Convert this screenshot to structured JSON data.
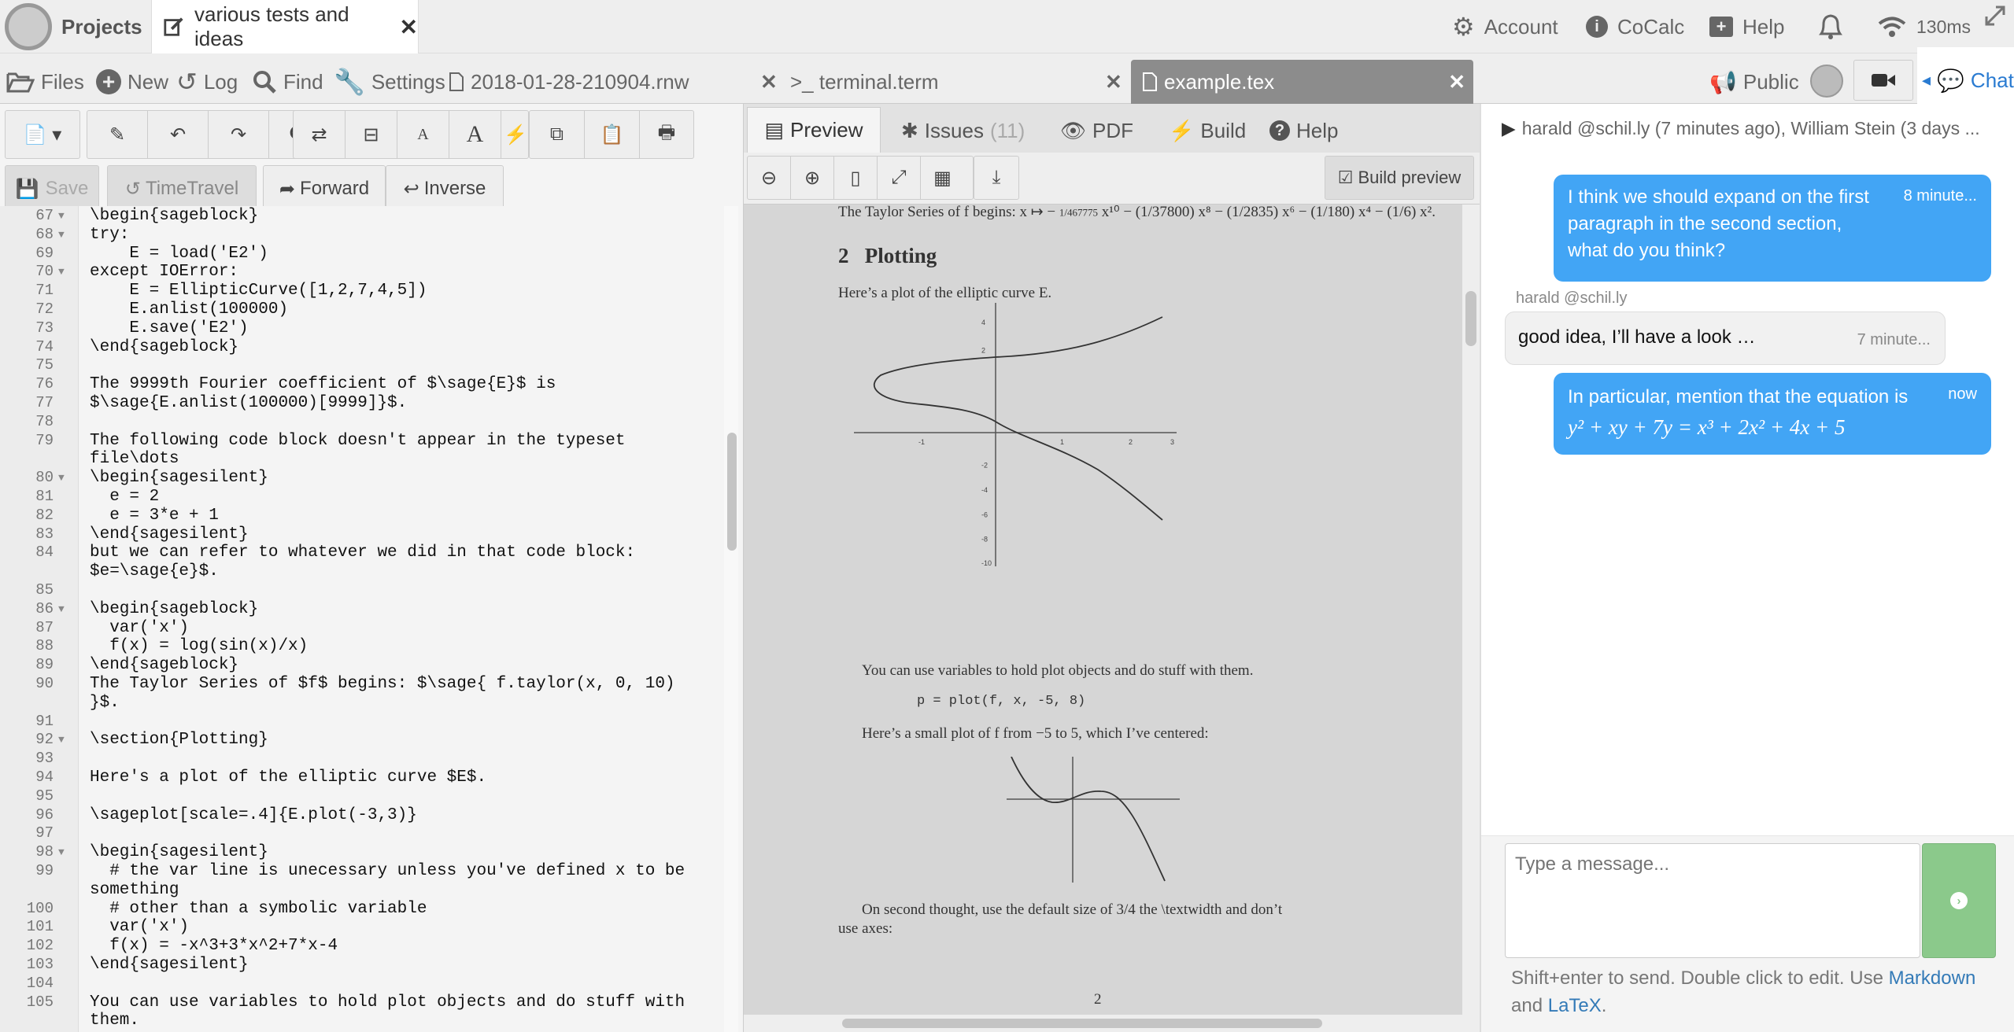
{
  "topbar": {
    "projects_label": "Projects",
    "doc_tab_title": "various tests and ideas",
    "account_label": "Account",
    "cocalc_label": "CoCalc",
    "help_label": "Help",
    "latency": "130ms"
  },
  "filebar": {
    "files": "Files",
    "new": "New",
    "log": "Log",
    "find": "Find",
    "settings": "Settings",
    "tab_rnw": "2018-01-28-210904.rnw",
    "tab_terminal": ">_ terminal.term",
    "tab_tex": "example.tex",
    "public": "Public",
    "chat": "Chat"
  },
  "editor_toolbar": {
    "save": "Save",
    "timetravel": "TimeTravel",
    "forward": "Forward",
    "inverse": "Inverse",
    "font_small": "A",
    "font_large": "A"
  },
  "code_lines": [
    {
      "n": "67",
      "fold": true,
      "text": "\\begin{sageblock}"
    },
    {
      "n": "68",
      "fold": true,
      "text": "try:"
    },
    {
      "n": "69",
      "fold": false,
      "text": "    E = load('E2')"
    },
    {
      "n": "70",
      "fold": true,
      "text": "except IOError:"
    },
    {
      "n": "71",
      "fold": false,
      "text": "    E = EllipticCurve([1,2,7,4,5])"
    },
    {
      "n": "72",
      "fold": false,
      "text": "    E.anlist(100000)"
    },
    {
      "n": "73",
      "fold": false,
      "text": "    E.save('E2')"
    },
    {
      "n": "74",
      "fold": false,
      "text": "\\end{sageblock}"
    },
    {
      "n": "75",
      "fold": false,
      "text": ""
    },
    {
      "n": "76",
      "fold": false,
      "text": "The 9999th Fourier coefficient of $\\sage{E}$ is"
    },
    {
      "n": "77",
      "fold": false,
      "text": "$\\sage{E.anlist(100000)[9999]}$."
    },
    {
      "n": "78",
      "fold": false,
      "text": ""
    },
    {
      "n": "79",
      "fold": false,
      "text": "The following code block doesn't appear in the typeset"
    },
    {
      "n": "",
      "fold": false,
      "text": "file\\dots"
    },
    {
      "n": "80",
      "fold": true,
      "text": "\\begin{sagesilent}"
    },
    {
      "n": "81",
      "fold": false,
      "text": "  e = 2"
    },
    {
      "n": "82",
      "fold": false,
      "text": "  e = 3*e + 1"
    },
    {
      "n": "83",
      "fold": false,
      "text": "\\end{sagesilent}"
    },
    {
      "n": "84",
      "fold": false,
      "text": "but we can refer to whatever we did in that code block:"
    },
    {
      "n": "",
      "fold": false,
      "text": "$e=\\sage{e}$."
    },
    {
      "n": "85",
      "fold": false,
      "text": ""
    },
    {
      "n": "86",
      "fold": true,
      "text": "\\begin{sageblock}"
    },
    {
      "n": "87",
      "fold": false,
      "text": "  var('x')"
    },
    {
      "n": "88",
      "fold": false,
      "text": "  f(x) = log(sin(x)/x)"
    },
    {
      "n": "89",
      "fold": false,
      "text": "\\end{sageblock}"
    },
    {
      "n": "90",
      "fold": false,
      "text": "The Taylor Series of $f$ begins: $\\sage{ f.taylor(x, 0, 10)"
    },
    {
      "n": "",
      "fold": false,
      "text": "}$."
    },
    {
      "n": "91",
      "fold": false,
      "text": ""
    },
    {
      "n": "92",
      "fold": true,
      "text": "\\section{Plotting}"
    },
    {
      "n": "93",
      "fold": false,
      "text": ""
    },
    {
      "n": "94",
      "fold": false,
      "text": "Here's a plot of the elliptic curve $E$."
    },
    {
      "n": "95",
      "fold": false,
      "text": ""
    },
    {
      "n": "96",
      "fold": false,
      "text": "\\sageplot[scale=.4]{E.plot(-3,3)}"
    },
    {
      "n": "97",
      "fold": false,
      "text": ""
    },
    {
      "n": "98",
      "fold": true,
      "text": "\\begin{sagesilent}"
    },
    {
      "n": "99",
      "fold": false,
      "text": "  # the var line is unecessary unless you've defined x to be"
    },
    {
      "n": "",
      "fold": false,
      "text": "something"
    },
    {
      "n": "100",
      "fold": false,
      "text": "  # other than a symbolic variable"
    },
    {
      "n": "101",
      "fold": false,
      "text": "  var('x')"
    },
    {
      "n": "102",
      "fold": false,
      "text": "  f(x) = -x^3+3*x^2+7*x-4"
    },
    {
      "n": "103",
      "fold": false,
      "text": "\\end{sagesilent}"
    },
    {
      "n": "104",
      "fold": false,
      "text": ""
    },
    {
      "n": "105",
      "fold": false,
      "text": "You can use variables to hold plot objects and do stuff with"
    },
    {
      "n": "",
      "fold": false,
      "text": "them."
    }
  ],
  "preview": {
    "tab_preview": "Preview",
    "tab_issues": "Issues",
    "issues_count": "(11)",
    "tab_pdf": "PDF",
    "tab_build": "Build",
    "tab_help": "Help",
    "build_preview": "Build preview",
    "taylor_text": "The Taylor Series of f begins: x ↦ −",
    "taylor_rest": "x¹⁰ − (1/37800) x⁸ − (1/2835) x⁶ − (1/180) x⁴ − (1/6) x².",
    "taylor_frac": "1/467775",
    "section_num": "2",
    "section_title": "Plotting",
    "elliptic_text": "Here’s a plot of the elliptic curve E.",
    "vars_text": "You can use variables to hold plot objects and do stuff with them.",
    "plot_code": "p = plot(f, x, -5, 8)",
    "small_plot_text": "Here’s a small plot of f from −5 to 5, which I’ve centered:",
    "second_thought": "On second thought, use the default size of 3/4 the \\textwidth and don’t",
    "use_axes": "use axes:",
    "page_number": "2",
    "plot1_ticks": {
      "x": [
        "-1",
        "1",
        "2",
        "3"
      ],
      "y": [
        "4",
        "2",
        "-2",
        "-4",
        "-6",
        "-8",
        "-10"
      ]
    }
  },
  "chat": {
    "header": "harald @schil.ly (7 minutes ago), William Stein (3 days ...",
    "msg1": "I think we should expand on the first paragraph in the second section, what do you think?",
    "msg1_time": "8 minute...",
    "sender2": "harald @schil.ly",
    "msg2": "good idea, I’ll have a look …",
    "msg2_time": "7 minute...",
    "msg3": "In particular, mention that the equation is",
    "msg3_eq": "y² + xy + 7y = x³ + 2x² + 4x + 5",
    "msg3_time": "now",
    "placeholder": "Type a message...",
    "hint_prefix": "Shift+enter to send. Double click to edit. Use",
    "markdown": "Markdown",
    "hint_and": "and",
    "latex": "LaTeX",
    "hint_end": "."
  },
  "colors": {
    "chat_blue": "#42a5f5",
    "send_green": "#8bc98b",
    "link_blue": "#337ab7"
  }
}
